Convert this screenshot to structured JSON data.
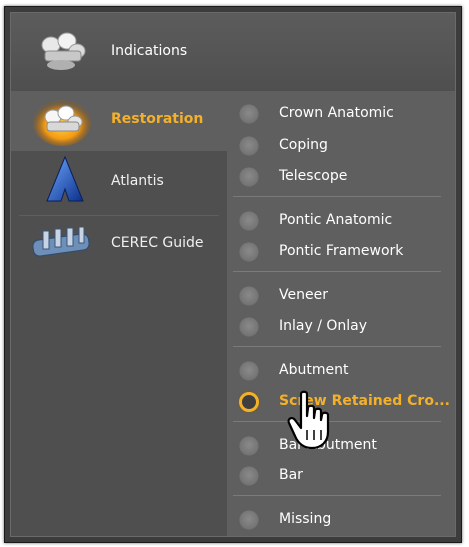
{
  "header": {
    "label": "Indications",
    "icon": "crowns-icon"
  },
  "categories": [
    {
      "label": "Restoration",
      "icon": "restoration-icon",
      "active": true
    },
    {
      "label": "Atlantis",
      "icon": "atlantis-icon",
      "active": false
    },
    {
      "label": "CEREC Guide",
      "icon": "cerec-guide-icon",
      "active": false
    }
  ],
  "options": [
    {
      "label": "Crown Anatomic"
    },
    {
      "label": "Coping"
    },
    {
      "label": "Telescope"
    },
    {
      "label": "Pontic Anatomic"
    },
    {
      "label": "Pontic Framework"
    },
    {
      "label": "Veneer"
    },
    {
      "label": "Inlay / Onlay"
    },
    {
      "label": "Abutment"
    },
    {
      "label": "Screw Retained Cro...",
      "selected": true
    },
    {
      "label": "Bar Abutment"
    },
    {
      "label": "Bar"
    },
    {
      "label": "Missing"
    }
  ],
  "colors": {
    "accent": "#f3b12b",
    "panel": "#5a5a5a"
  }
}
